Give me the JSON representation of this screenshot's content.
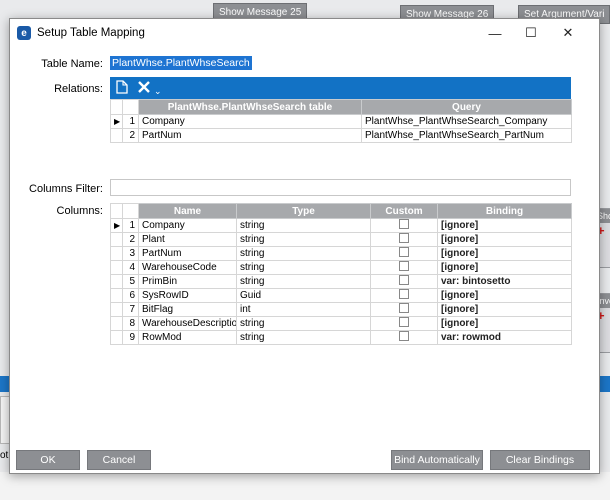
{
  "background": {
    "workflow_nodes": [
      "Show Message 25",
      "Show Message 26",
      "Set Argument/Vari"
    ],
    "side_cards": [
      "Sho",
      "Invo"
    ],
    "left_edge_text": "ot"
  },
  "dialog": {
    "title": "Setup Table Mapping",
    "icon": "app-e-icon",
    "window_buttons": {
      "minimize": "—",
      "maximize": "☐",
      "close": "✕"
    },
    "table_name_label": "Table Name:",
    "table_name_value": "PlantWhse.PlantWhseSearch",
    "relations_label": "Relations:",
    "relations_toolbar": {
      "add_icon": "document-icon",
      "delete_icon": "x-icon",
      "more_icon": "chevron-down-icon"
    },
    "relations_columns": [
      "PlantWhse.PlantWhseSearch table",
      "Query"
    ],
    "relations_rows": [
      {
        "num": "1",
        "table": "Company",
        "query": "PlantWhse_PlantWhseSearch_Company"
      },
      {
        "num": "2",
        "table": "PartNum",
        "query": "PlantWhse_PlantWhseSearch_PartNum"
      }
    ],
    "columns_filter_label": "Columns Filter:",
    "columns_filter_value": "",
    "columns_label": "Columns:",
    "columns_headers": [
      "Name",
      "Type",
      "Custom",
      "Binding"
    ],
    "columns_rows": [
      {
        "num": "1",
        "name": "Company",
        "type": "string",
        "binding": "[ignore]"
      },
      {
        "num": "2",
        "name": "Plant",
        "type": "string",
        "binding": "[ignore]"
      },
      {
        "num": "3",
        "name": "PartNum",
        "type": "string",
        "binding": "[ignore]"
      },
      {
        "num": "4",
        "name": "WarehouseCode",
        "type": "string",
        "binding": "[ignore]"
      },
      {
        "num": "5",
        "name": "PrimBin",
        "type": "string",
        "binding": "var: bintosetto"
      },
      {
        "num": "6",
        "name": "SysRowID",
        "type": "Guid",
        "binding": "[ignore]"
      },
      {
        "num": "7",
        "name": "BitFlag",
        "type": "int",
        "binding": "[ignore]"
      },
      {
        "num": "8",
        "name": "WarehouseDescriptio",
        "type": "string",
        "binding": "[ignore]"
      },
      {
        "num": "9",
        "name": "RowMod",
        "type": "string",
        "binding": "var: rowmod"
      }
    ],
    "buttons": {
      "ok": "OK",
      "cancel": "Cancel",
      "bind_automatically": "Bind Automatically",
      "clear_bindings": "Clear Bindings"
    }
  }
}
